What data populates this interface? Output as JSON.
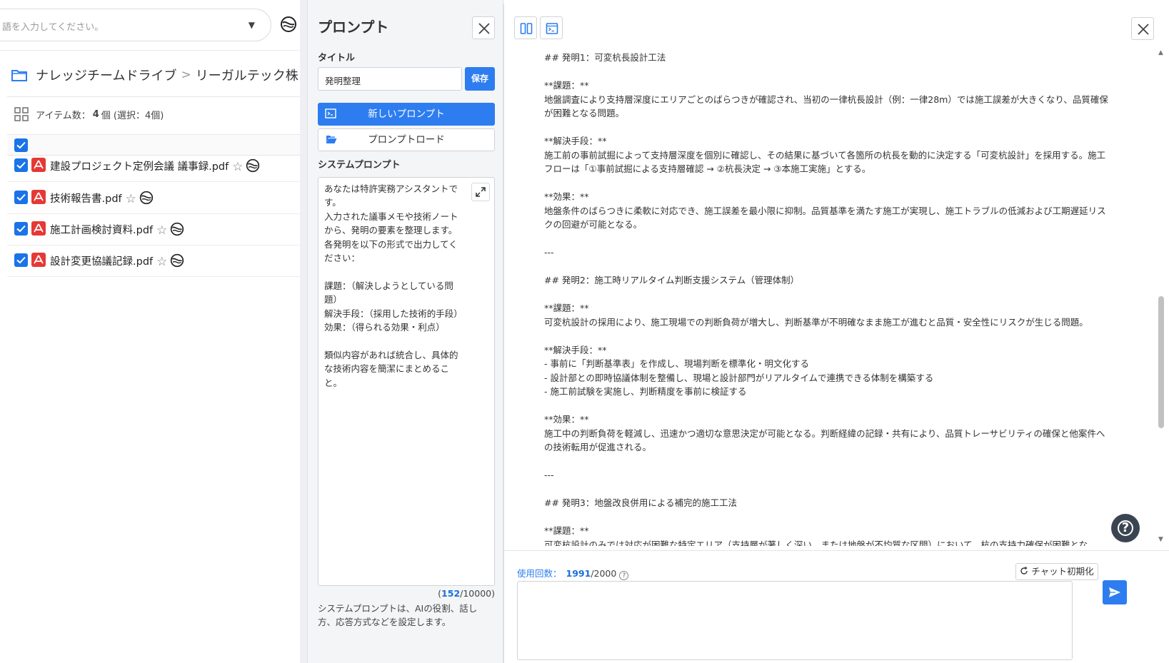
{
  "search": {
    "placeholder": "語を入力してください。",
    "caret": "▼"
  },
  "breadcrumb": {
    "items": [
      "ナレッジチームドライブ",
      "リーガルテック株"
    ],
    "separator": ">"
  },
  "file_list": {
    "count_label": "アイテム数：",
    "count_value": "4",
    "count_suffix": "個 (選択：4個)",
    "files": [
      {
        "name": "建設プロジェクト定例会議 議事録.pdf"
      },
      {
        "name": "技術報告書.pdf"
      },
      {
        "name": "施工計画検討資料.pdf"
      },
      {
        "name": "設計変更協議記録.pdf"
      }
    ],
    "star": "☆"
  },
  "prompt_panel": {
    "title": "プロンプト",
    "title_label": "タイトル",
    "title_value": "発明整理",
    "save_label": "保存",
    "new_prompt_label": "新しいプロンプト",
    "load_label": "プロンプトロード",
    "system_label": "システムプロンプト",
    "system_text": "あなたは特許実務アシスタントです。\n入力された議事メモや技術ノートから、発明の要素を整理します。\n各発明を以下の形式で出力してください：\n\n課題：（解決しようとしている問題）\n解決手段：（採用した技術的手段）\n効果：（得られる効果・利点）\n\n類似内容があれば統合し、具体的な技術内容を簡潔にまとめること。",
    "char_count": "152",
    "char_max": "/10000)",
    "char_open": "(",
    "help_text": "システムプロンプトは、AIの役割、話し方、応答方式などを設定します。"
  },
  "chat": {
    "content": "## 発明1：可変杭長設計工法\n\n**課題：**\n地盤調査により支持層深度にエリアごとのばらつきが確認され、当初の一律杭長設計（例：一律28m）では施工誤差が大きくなり、品質確保が困難となる問題。\n\n**解決手段：**\n施工前の事前試掘によって支持層深度を個別に確認し、その結果に基づいて各箇所の杭長を動的に決定する「可変杭設計」を採用する。施工フローは「①事前試掘による支持層確認 → ②杭長決定 → ③本施工実施」とする。\n\n**効果：**\n地盤条件のばらつきに柔軟に対応でき、施工誤差を最小限に抑制。品質基準を満たす施工が実現し、施工トラブルの低減および工期遅延リスクの回避が可能となる。\n\n---\n\n## 発明2：施工時リアルタイム判断支援システム（管理体制）\n\n**課題：**\n可変杭設計の採用により、施工現場での判断負荷が増大し、判断基準が不明確なまま施工が進むと品質・安全性にリスクが生じる問題。\n\n**解決手段：**\n- 事前に「判断基準表」を作成し、現場判断を標準化・明文化する\n- 設計部との即時協議体制を整備し、現場と設計部門がリアルタイムで連携できる体制を構築する\n- 施工前試験を実施し、判断精度を事前に検証する\n\n**効果：**\n施工中の判断負荷を軽減し、迅速かつ適切な意思決定が可能となる。判断経緯の記録・共有により、品質トレーサビリティの確保と他案件への技術転用が促進される。\n\n---\n\n## 発明3：地盤改良併用による補完的施工工法\n\n**課題：**\n可変杭設計のみでは対応が困難な特定エリア（支持層が著しく深い、または地盤が不均質な区間）において、杭の支持力確保が困難とな",
    "usage_label": "使用回数：",
    "usage_value": "1991",
    "usage_max": "/2000",
    "usage_help": "?",
    "reset_label": "チャット初期化",
    "help_fab": "?"
  },
  "colors": {
    "accent": "#2d7df0",
    "pdf_red": "#e53935",
    "checkbox": "#1a73e8"
  }
}
